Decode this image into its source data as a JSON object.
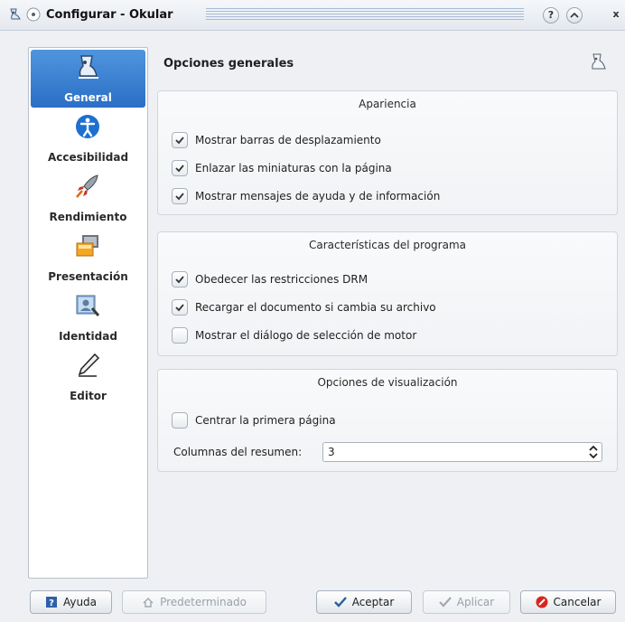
{
  "window": {
    "title": "Configurar - Okular",
    "help_glyph": "?",
    "shade_glyph": "^",
    "close_glyph": "x"
  },
  "sidebar": {
    "items": [
      {
        "label": "General",
        "icon": "okular-icon",
        "active": true
      },
      {
        "label": "Accesibilidad",
        "icon": "accessibility-icon",
        "active": false
      },
      {
        "label": "Rendimiento",
        "icon": "rocket-icon",
        "active": false
      },
      {
        "label": "Presentación",
        "icon": "presentation-icon",
        "active": false
      },
      {
        "label": "Identidad",
        "icon": "identity-icon",
        "active": false
      },
      {
        "label": "Editor",
        "icon": "editor-pen-icon",
        "active": false
      }
    ]
  },
  "page": {
    "title": "Opciones generales"
  },
  "groups": {
    "appearance": {
      "title": "Apariencia",
      "options": [
        {
          "label": "Mostrar barras de desplazamiento",
          "checked": true
        },
        {
          "label": "Enlazar las miniaturas con la página",
          "checked": true
        },
        {
          "label": "Mostrar mensajes de ayuda y de información",
          "checked": true
        }
      ]
    },
    "features": {
      "title": "Características del programa",
      "options": [
        {
          "label": "Obedecer las restricciones DRM",
          "checked": true
        },
        {
          "label": "Recargar el documento si cambia su archivo",
          "checked": true
        },
        {
          "label": "Mostrar el diálogo de selección de motor",
          "checked": false
        }
      ]
    },
    "view": {
      "title": "Opciones de visualización",
      "center_first_page": {
        "label": "Centrar la primera página",
        "checked": false
      },
      "columns_label": "Columnas del resumen:",
      "columns_value": "3"
    }
  },
  "buttons": {
    "help": "Ayuda",
    "defaults": "Predeterminado",
    "accept": "Aceptar",
    "apply": "Aplicar",
    "cancel": "Cancelar"
  },
  "colors": {
    "accent": "#2a6fc6",
    "window_bg": "#eef0f3",
    "cancel_red": "#d7261e"
  }
}
